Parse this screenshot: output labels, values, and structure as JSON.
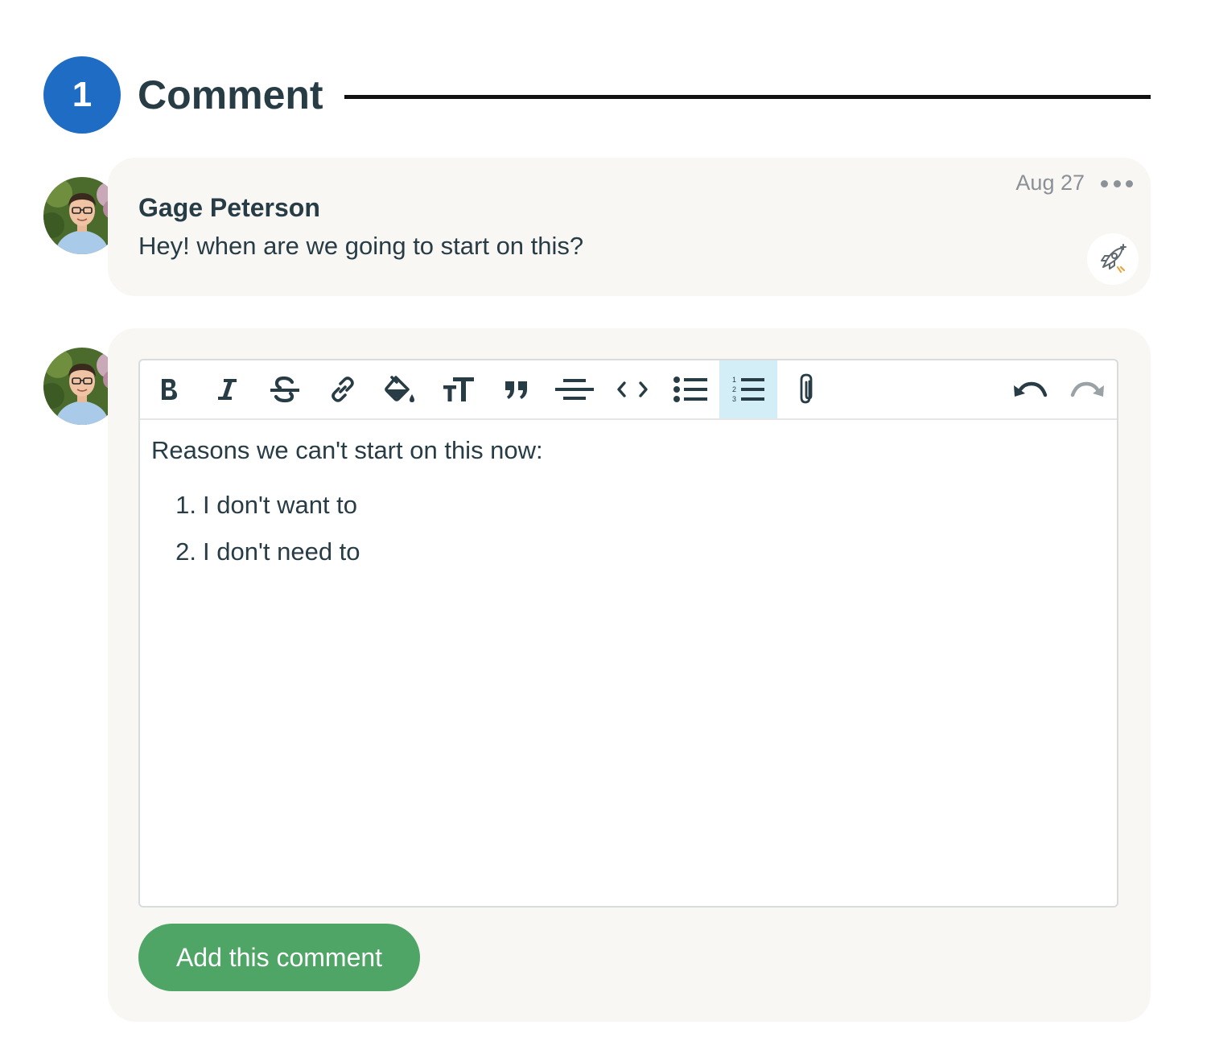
{
  "header": {
    "count": "1",
    "title": "Comment"
  },
  "comment": {
    "author": "Gage Peterson",
    "date": "Aug 27",
    "body": "Hey! when are we going to start on this?",
    "more_icon": "more-horizontal-icon",
    "boost_icon": "rocket-boost-icon"
  },
  "editor": {
    "toolbar": [
      {
        "name": "bold",
        "icon": "bold-icon",
        "active": false
      },
      {
        "name": "italic",
        "icon": "italic-icon",
        "active": false
      },
      {
        "name": "strikethrough",
        "icon": "strikethrough-icon",
        "active": false
      },
      {
        "name": "link",
        "icon": "link-icon",
        "active": false
      },
      {
        "name": "color",
        "icon": "paint-bucket-icon",
        "active": false
      },
      {
        "name": "heading",
        "icon": "text-size-icon",
        "active": false
      },
      {
        "name": "quote",
        "icon": "quote-icon",
        "active": false
      },
      {
        "name": "horizontal-rule",
        "icon": "horizontal-rule-icon",
        "active": false
      },
      {
        "name": "code",
        "icon": "code-icon",
        "active": false
      },
      {
        "name": "bullet-list",
        "icon": "bullet-list-icon",
        "active": false
      },
      {
        "name": "numbered-list",
        "icon": "numbered-list-icon",
        "active": true
      },
      {
        "name": "attach",
        "icon": "paperclip-icon",
        "active": false
      },
      {
        "name": "undo",
        "icon": "undo-icon",
        "active": false
      },
      {
        "name": "redo",
        "icon": "redo-icon",
        "active": false
      }
    ],
    "content": {
      "intro": "Reasons we can't start on this now:",
      "items": [
        {
          "number": "1.",
          "text": "I don't want to"
        },
        {
          "number": "2.",
          "text": "I don't need to"
        }
      ]
    }
  },
  "submit_label": "Add this comment",
  "colors": {
    "badge": "#1f6cc4",
    "submit": "#4fa566",
    "active_tool": "#d4eef8",
    "card": "#f8f7f4",
    "text": "#283c46"
  }
}
